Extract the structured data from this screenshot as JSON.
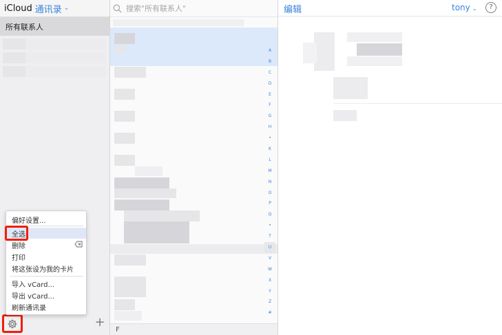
{
  "header": {
    "brand": "iCloud",
    "app_name": "通讯录"
  },
  "groups": {
    "selected": "所有联系人"
  },
  "search": {
    "placeholder": "搜索\"所有联系人\""
  },
  "menu": {
    "items": [
      {
        "label": "偏好设置..."
      },
      {
        "label": "全选"
      },
      {
        "label": "删除"
      },
      {
        "label": "打印"
      },
      {
        "label": "将这张设为我的卡片"
      },
      {
        "label": "导入 vCard..."
      },
      {
        "label": "导出 vCard..."
      },
      {
        "label": "刷新通讯录"
      }
    ]
  },
  "alphabet": [
    "A",
    "B",
    "C",
    "D",
    "E",
    "F",
    "G",
    "H",
    "•",
    "K",
    "L",
    "M",
    "N",
    "O",
    "P",
    "Q",
    "•",
    "T",
    "U",
    "V",
    "W",
    "X",
    "Y",
    "Z",
    "#"
  ],
  "current_letter": "U",
  "contacts_footer": "F",
  "card": {
    "edit_label": "编辑",
    "user_name": "tony",
    "help_label": "?"
  },
  "colors": {
    "accent": "#3a83d9",
    "highlight_red": "#ee1f00",
    "selected_row": "#dbe9fb"
  }
}
